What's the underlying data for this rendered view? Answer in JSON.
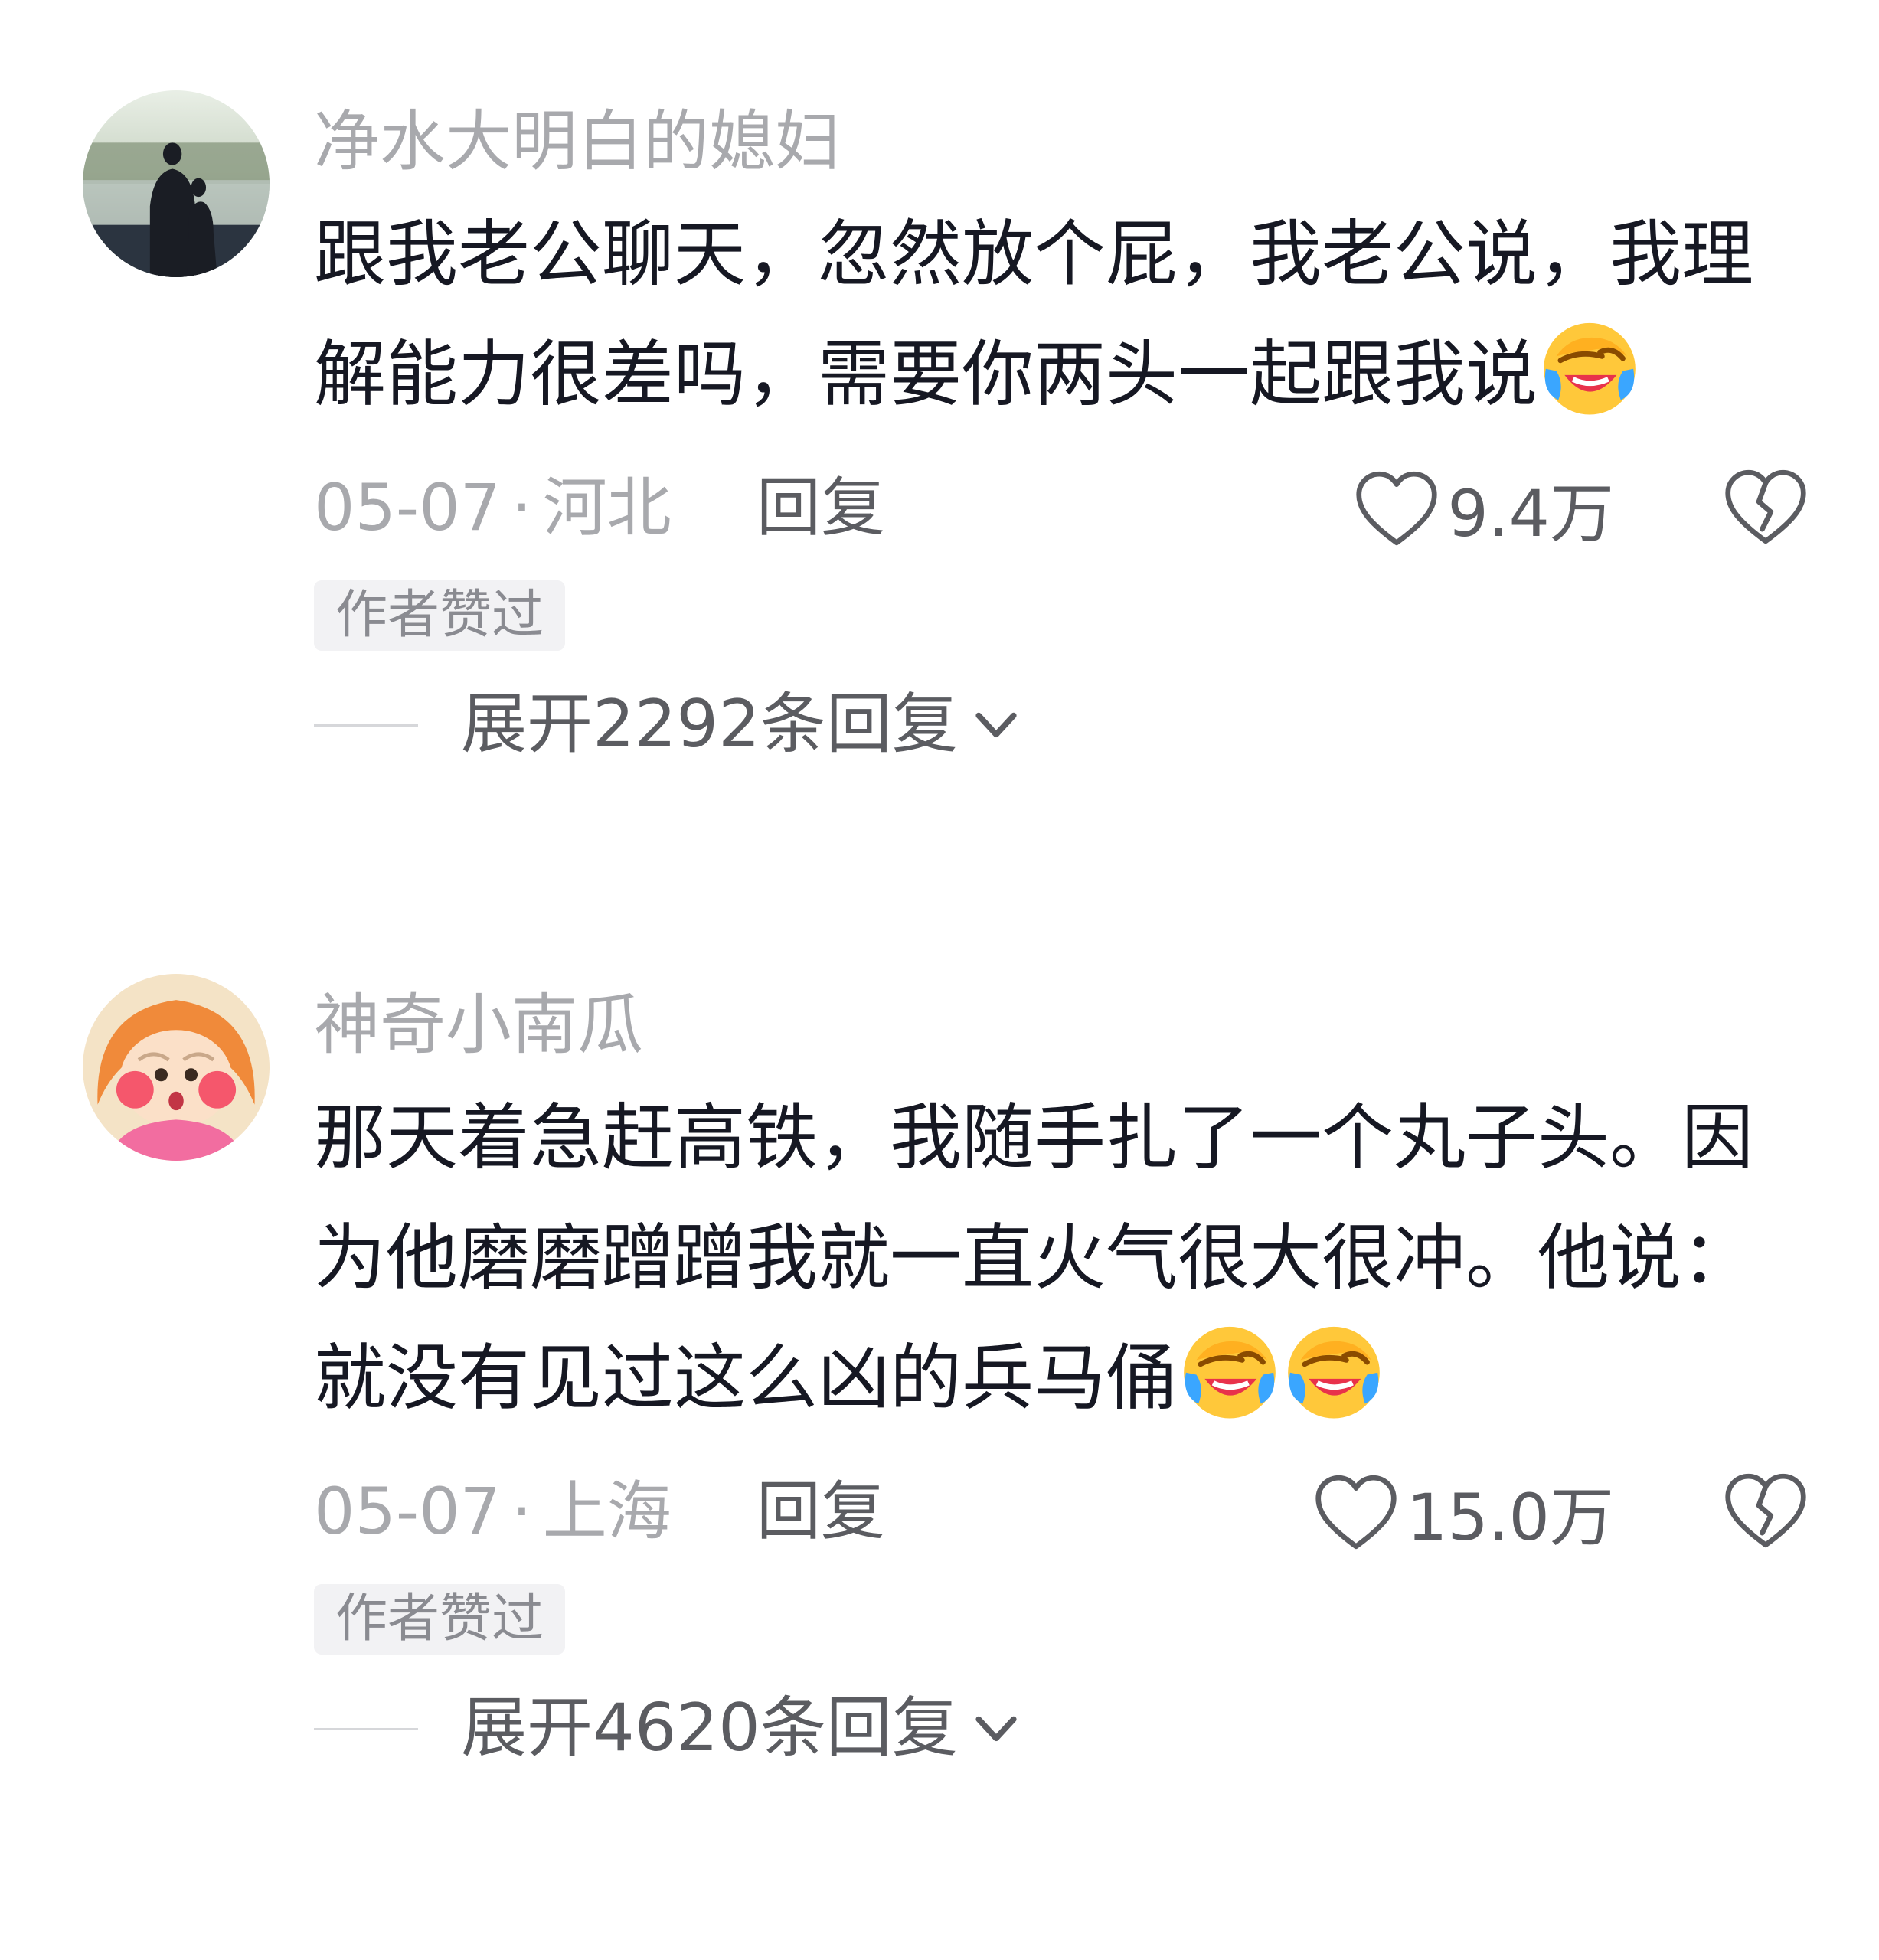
{
  "comments": [
    {
      "username": "净水大明白的媳妇",
      "avatar_icon": "avatar-silhouette-photo",
      "text": "跟我老公聊天，忽然放个屁，我老公说，我理解能力很差吗，需要你两头一起跟我说",
      "emoji_icons": [
        "laugh-cry-emoji"
      ],
      "date": "05-07",
      "separator": "·",
      "location": "河北",
      "reply_label": "回复",
      "like_count": "9.4万",
      "badge": "作者赞过",
      "expand_label": "展开2292条回复"
    },
    {
      "username": "神奇小南瓜",
      "avatar_icon": "avatar-cartoon-girl",
      "text": "那天着急赶高铁，我随手扎了一个丸子头。因为他磨磨蹭蹭我就一直火气很大很冲。他说：就没有见过这么凶的兵马俑",
      "emoji_icons": [
        "laugh-cry-emoji",
        "laugh-cry-emoji"
      ],
      "date": "05-07",
      "separator": "·",
      "location": "上海",
      "reply_label": "回复",
      "like_count": "15.0万",
      "badge": "作者赞过",
      "expand_label": "展开4620条回复"
    }
  ],
  "colors": {
    "text": "#161823",
    "secondary": "#a8a9ad",
    "action": "#5b5c61",
    "badge_bg": "#f2f2f4"
  }
}
